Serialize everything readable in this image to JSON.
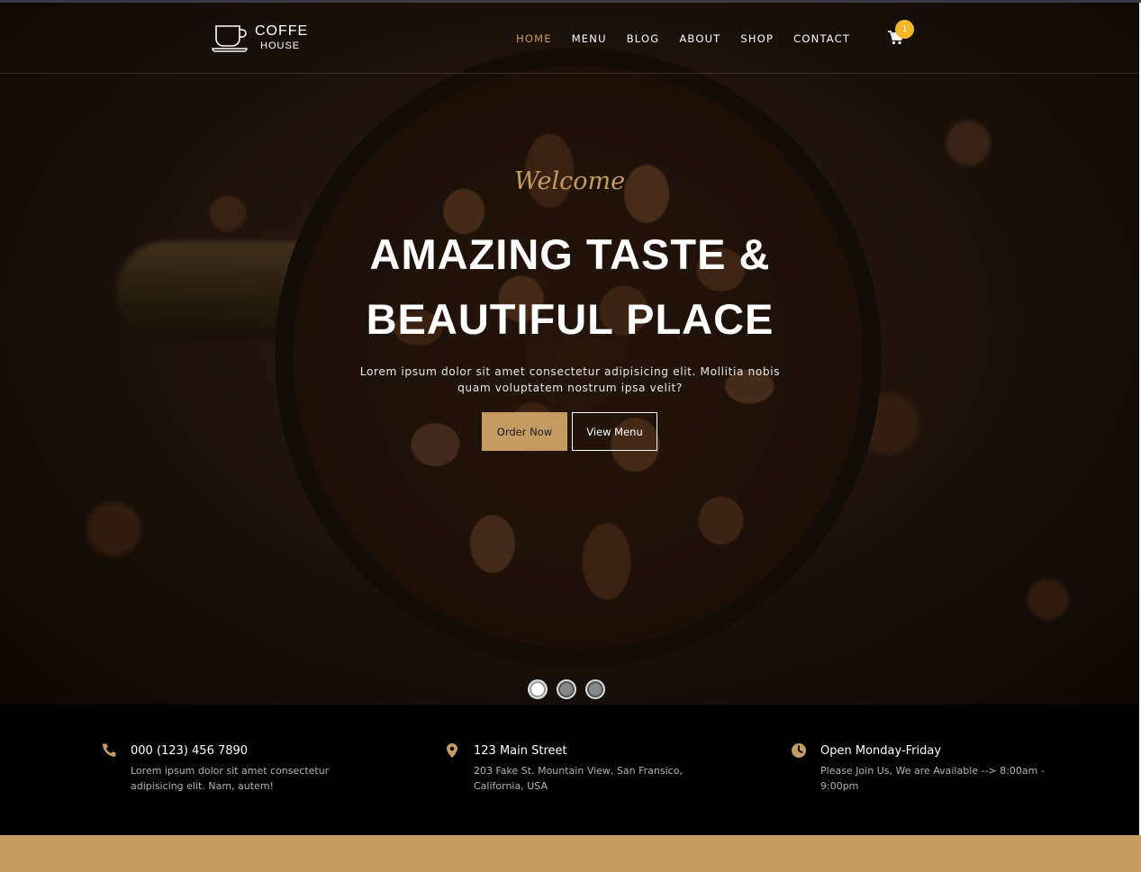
{
  "brand": {
    "name": "COFFE",
    "sub": "HOUSE"
  },
  "nav": {
    "items": [
      "HOME",
      "MENU",
      "BLOG",
      "ABOUT",
      "SHOP",
      "CONTACT"
    ],
    "active": "HOME",
    "cart_count": "1"
  },
  "hero": {
    "welcome": "Welcome",
    "headline": "AMAZING TASTE & BEAUTIFUL PLACE",
    "subtext": "Lorem ipsum dolor sit amet consectetur adipisicing elit. Mollitia nobis quam voluptatem nostrum ipsa velit?",
    "order_button": "Order Now",
    "view_menu_button": "View Menu",
    "slide_count": 3,
    "active_slide": 1
  },
  "info": {
    "phone": {
      "title": "000 (123) 456 7890",
      "desc": "Lorem ipsum dolor sit amet consectetur adipisicing elit. Nam, autem!"
    },
    "address": {
      "title": "123 Main Street",
      "desc": "203 Fake St. Mountain View, San Fransico, California, USA"
    },
    "hours": {
      "title": "Open Monday-Friday",
      "desc": "Please Join Us, We are Available --> 8:00am - 9:00pm"
    }
  },
  "colors": {
    "accent": "#c49b63",
    "badge": "#f5b62a"
  },
  "icons": {
    "logo": "coffee-cup-icon",
    "cart": "shopping-cart-icon",
    "phone": "phone-icon",
    "address": "map-pin-icon",
    "hours": "clock-icon"
  }
}
